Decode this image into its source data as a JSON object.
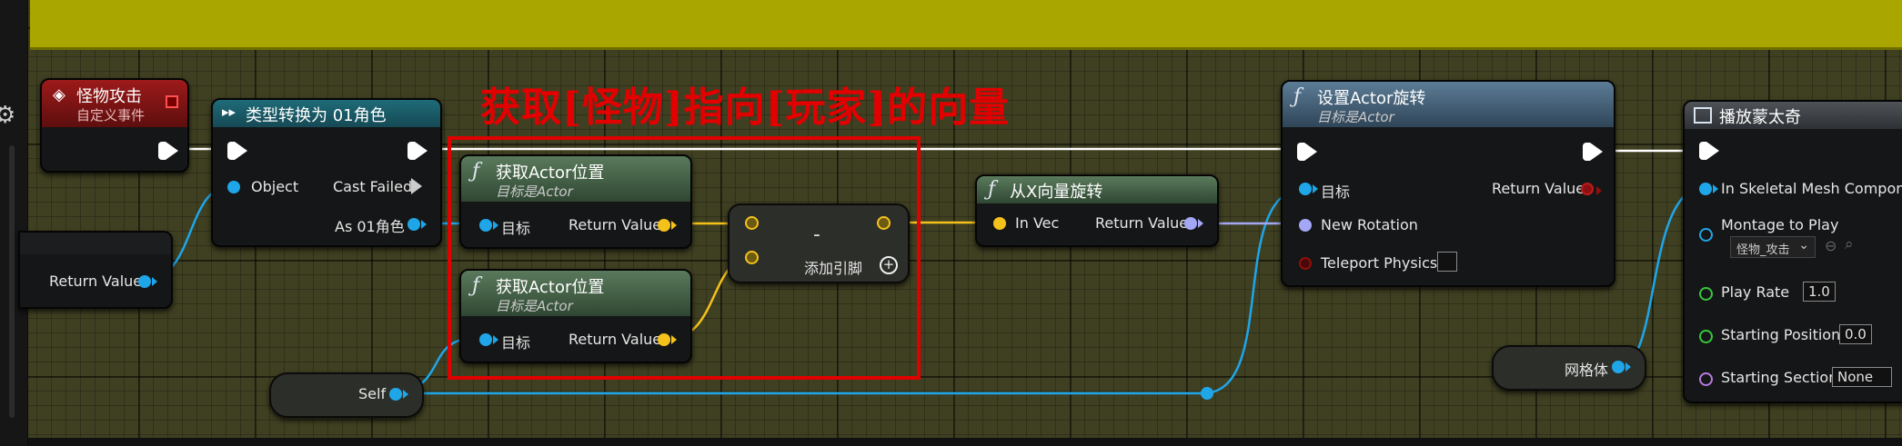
{
  "annotation": {
    "title": "获取[怪物]指向[玩家]的向量"
  },
  "nodes": {
    "custom_event": {
      "title": "怪物攻击",
      "subtitle": "自定义事件"
    },
    "cast": {
      "title": "类型转换为 01角色",
      "object_label": "Object",
      "cast_failed_label": "Cast Failed",
      "as_label": "As 01角色"
    },
    "partial_left": {
      "return_label": "Return Value"
    },
    "get_loc_1": {
      "title": "获取Actor位置",
      "subtitle": "目标是Actor",
      "target_label": "目标",
      "return_label": "Return Value"
    },
    "get_loc_2": {
      "title": "获取Actor位置",
      "subtitle": "目标是Actor",
      "target_label": "目标",
      "return_label": "Return Value"
    },
    "subtract": {
      "symbol": "-",
      "add_pin_label": "添加引脚"
    },
    "rot_from_x": {
      "title": "从X向量旋转",
      "in_label": "In Vec",
      "return_label": "Return Value"
    },
    "self": {
      "label": "Self"
    },
    "set_rotation": {
      "title": "设置Actor旋转",
      "subtitle": "目标是Actor",
      "target_label": "目标",
      "return_label": "Return Value",
      "new_rotation_label": "New Rotation",
      "teleport_label": "Teleport Physics"
    },
    "mesh": {
      "label": "网格体"
    },
    "montage": {
      "title": "播放蒙太奇",
      "skeletal_label": "In Skeletal Mesh Componer",
      "montage_label": "Montage to Play",
      "montage_value": "怪物_攻击",
      "play_rate_label": "Play Rate",
      "play_rate_value": "1.0",
      "start_pos_label": "Starting Position",
      "start_pos_value": "0.0",
      "start_section_label": "Starting Section",
      "start_section_value": "None"
    }
  },
  "colors": {
    "comment": "#aaa600",
    "annotation": "#e00000",
    "object_pin": "#1fa6e8",
    "vector_pin": "#f5c21b",
    "rotator_pin": "#a3a7f5",
    "bool_pin": "#8e0f0f",
    "float_pin": "#36c83b",
    "name_pin": "#b57be0"
  }
}
